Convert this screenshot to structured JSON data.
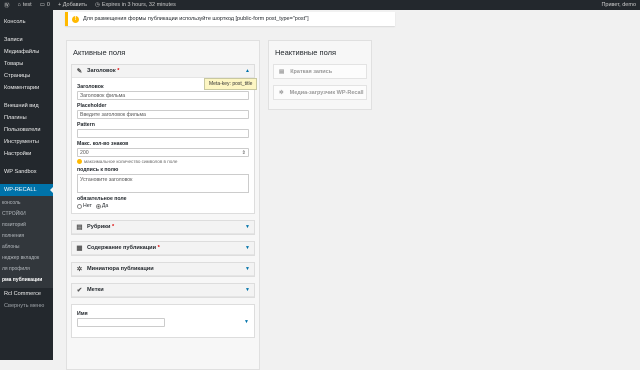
{
  "adminbar": {
    "site": "test",
    "comments": "0",
    "add_new": "+ Добавить",
    "expires": "Expires in 3 hours, 32 minutes",
    "greeting": "Привет, demo"
  },
  "menu": {
    "items": [
      "Консоль",
      "Записи",
      "Медиафайлы",
      "Товары",
      "Страницы",
      "Комментарии",
      "Внешний вид",
      "Плагины",
      "Пользователи",
      "Инструменты",
      "Настройки",
      "WP Sandbox",
      "WP-RECALL"
    ],
    "sub": [
      "консоль",
      "СТРОЙКИ",
      "позиторий",
      "полнения",
      "аблоны",
      "неджер вкладок",
      "ля профиля",
      "рма публикации"
    ],
    "after": [
      "Rcl Commerce",
      "Свернуть меню"
    ]
  },
  "notice": {
    "text": "Для размещения формы публикации используйте шорткод [public-form post_type=\"post\"]"
  },
  "active": {
    "title": "Активные поля",
    "title_field": {
      "label": "Заголовок",
      "req": "*",
      "l_heading": "Заголовок",
      "v_heading": "Заголовок фильма",
      "l_placeholder": "Placeholder",
      "v_placeholder": "Введите заголовок фильма",
      "l_pattern": "Pattern",
      "v_pattern": "",
      "l_max": "Макс. кол-во знаков",
      "v_max": "200",
      "hint": "максимальное количество символов в поле",
      "l_notice": "подпись к полю",
      "v_notice": "Установите заголовок",
      "l_required": "обязательное поле",
      "no": "Нет",
      "yes": "Да"
    },
    "tooltip": "Meta-key: post_title",
    "fields": [
      {
        "label": "Рубрики",
        "req": "*"
      },
      {
        "label": "Содержание публикации",
        "req": "*"
      },
      {
        "label": "Миниатюра публикации",
        "req": ""
      },
      {
        "label": "Метки",
        "req": ""
      }
    ],
    "name_label": "Имя"
  },
  "inactive": {
    "title": "Неактивные поля",
    "fields": [
      "Краткая запись",
      "Медиа-загрузчик WP-Recall"
    ]
  }
}
